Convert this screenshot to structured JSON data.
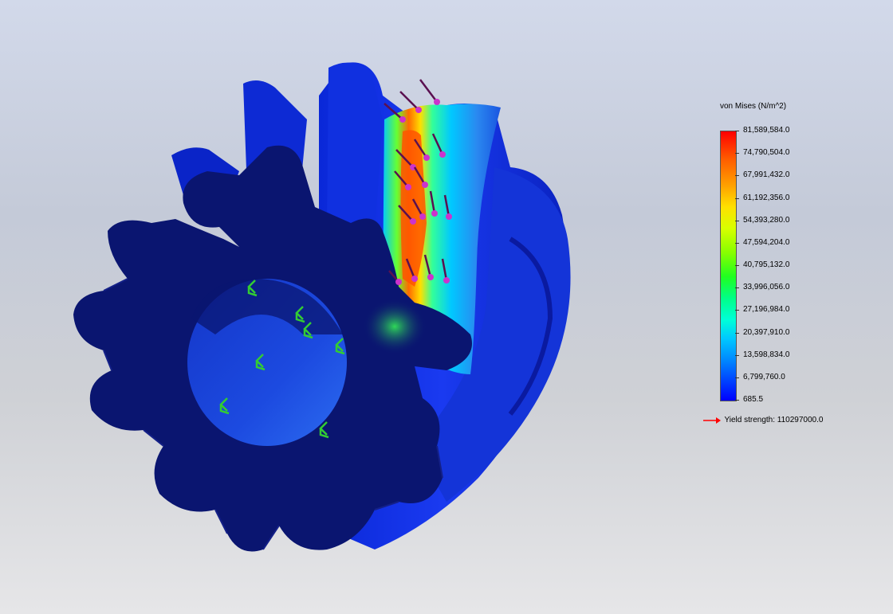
{
  "legend": {
    "title": "von Mises (N/m^2)",
    "ticks": [
      "81,589,584.0",
      "74,790,504.0",
      "67,991,432.0",
      "61,192,356.0",
      "54,393,280.0",
      "47,594,204.0",
      "40,795,132.0",
      "33,996,056.0",
      "27,196,984.0",
      "20,397,910.0",
      "13,598,834.0",
      "6,799,760.0",
      "685.5"
    ],
    "yield_label": "Yield strength: 110297000.0"
  },
  "colors": {
    "max_stress": "#ff0000",
    "min_stress": "#0000ff",
    "gear_body": "#0a1570",
    "load_arrow": "#cc33cc",
    "fixture_arrow": "#33cc33",
    "yield_arrow": "#ff0000"
  },
  "model": {
    "load_arrow_icon": "force-arrow-icon",
    "fixture_icon": "fixed-geometry-icon"
  }
}
